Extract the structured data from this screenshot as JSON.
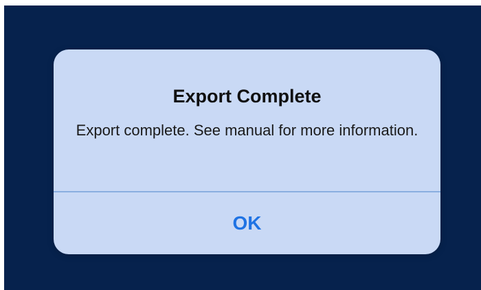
{
  "dialog": {
    "title": "Export Complete",
    "message": "Export complete. See manual for more information.",
    "ok_label": "OK"
  },
  "colors": {
    "backdrop": "#06224d",
    "dialog_background": "#c9d9f5",
    "divider": "#8aaee0",
    "button_text": "#1f73e4"
  }
}
